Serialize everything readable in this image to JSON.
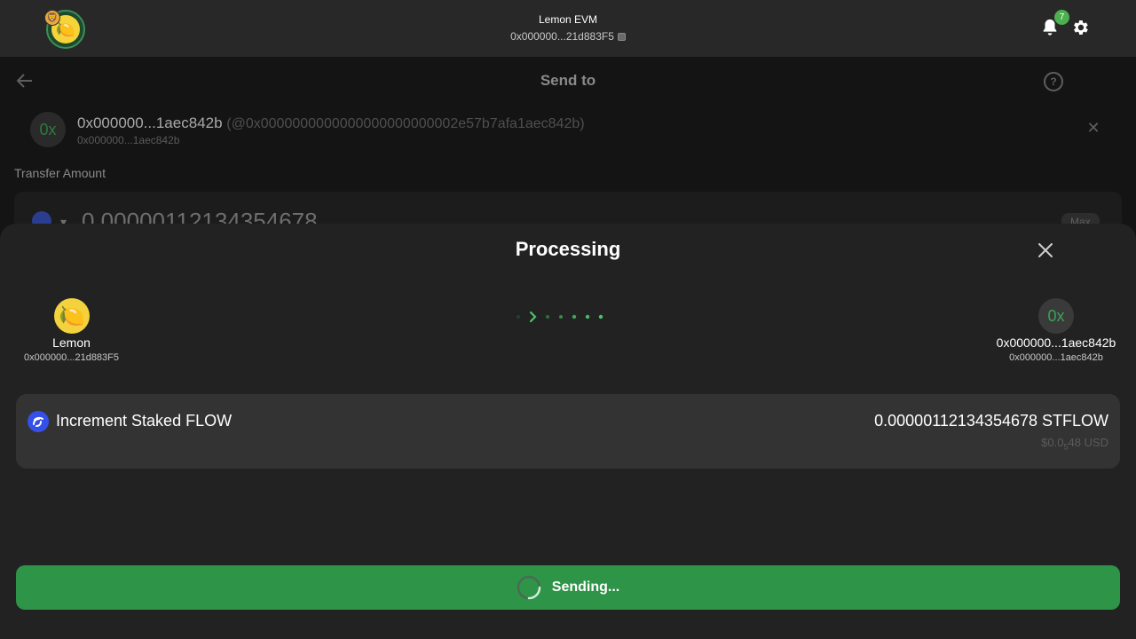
{
  "header": {
    "account_name": "Lemon EVM",
    "account_address": "0x000000...21d883F5",
    "notification_count": "7"
  },
  "send_page": {
    "title": "Send to",
    "recipient": {
      "avatar_text": "0x",
      "main_address": "0x000000...1aec842b",
      "alias": "(@0x0000000000000000000000002e57b7afa1aec842b)",
      "sub_address": "0x000000...1aec842b"
    },
    "transfer_label": "Transfer Amount",
    "amount_value": "0.00000112134354678",
    "max_label": "Max"
  },
  "processing": {
    "title": "Processing",
    "from": {
      "name": "Lemon",
      "address": "0x000000...21d883F5",
      "avatar_icon": "lemon-icon"
    },
    "to": {
      "avatar_text": "0x",
      "name": "0x000000...1aec842b",
      "address": "0x000000...1aec842b"
    },
    "token": {
      "name": "Increment Staked FLOW",
      "amount": "0.00000112134354678 STFLOW",
      "usd_prefix": "$0.0",
      "usd_sub": "5",
      "usd_suffix": "48 USD"
    },
    "send_button_label": "Sending..."
  },
  "colors": {
    "accent_green": "#2e9447",
    "badge_green": "#4caf50",
    "flow_blue": "#3550e8"
  }
}
